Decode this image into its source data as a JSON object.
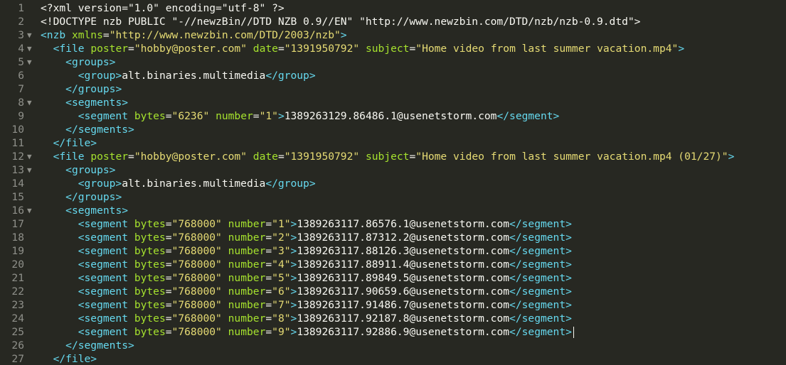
{
  "colors": {
    "background": "#272822",
    "text": "#f8f8f2",
    "tag": "#66d9ef",
    "attribute": "#a6e22e",
    "string": "#e6db74",
    "gutter": "#8f908a"
  },
  "editor": {
    "fold_icon": "▼",
    "lines": [
      {
        "n": "1",
        "fold": false,
        "indent": 0,
        "tokens": [
          {
            "t": "<?xml version=\"1.0\" encoding=\"utf-8\" ?>",
            "c": "txt"
          }
        ]
      },
      {
        "n": "2",
        "fold": false,
        "indent": 0,
        "tokens": [
          {
            "t": "<!DOCTYPE nzb PUBLIC \"-//newzBin//DTD NZB 0.9//EN\" \"http://www.newzbin.com/DTD/nzb/nzb-0.9.dtd\">",
            "c": "txt"
          }
        ]
      },
      {
        "n": "3",
        "fold": true,
        "indent": 0,
        "tokens": [
          {
            "t": "<nzb",
            "c": "tag"
          },
          {
            "t": " ",
            "c": "txt"
          },
          {
            "t": "xmlns",
            "c": "attr"
          },
          {
            "t": "=",
            "c": "txt"
          },
          {
            "t": "\"http://www.newzbin.com/DTD/2003/nzb\"",
            "c": "str"
          },
          {
            "t": ">",
            "c": "tag"
          }
        ]
      },
      {
        "n": "4",
        "fold": true,
        "indent": 1,
        "tokens": [
          {
            "t": "<file",
            "c": "tag"
          },
          {
            "t": " ",
            "c": "txt"
          },
          {
            "t": "poster",
            "c": "attr"
          },
          {
            "t": "=",
            "c": "txt"
          },
          {
            "t": "\"hobby@poster.com\"",
            "c": "str"
          },
          {
            "t": " ",
            "c": "txt"
          },
          {
            "t": "date",
            "c": "attr"
          },
          {
            "t": "=",
            "c": "txt"
          },
          {
            "t": "\"1391950792\"",
            "c": "str"
          },
          {
            "t": " ",
            "c": "txt"
          },
          {
            "t": "subject",
            "c": "attr"
          },
          {
            "t": "=",
            "c": "txt"
          },
          {
            "t": "\"Home video from last summer vacation.mp4\"",
            "c": "str"
          },
          {
            "t": ">",
            "c": "tag"
          }
        ]
      },
      {
        "n": "5",
        "fold": true,
        "indent": 2,
        "tokens": [
          {
            "t": "<groups>",
            "c": "tag"
          }
        ]
      },
      {
        "n": "6",
        "fold": false,
        "indent": 3,
        "tokens": [
          {
            "t": "<group>",
            "c": "tag"
          },
          {
            "t": "alt.binaries.multimedia",
            "c": "txt"
          },
          {
            "t": "</group>",
            "c": "tag"
          }
        ]
      },
      {
        "n": "7",
        "fold": false,
        "indent": 2,
        "tokens": [
          {
            "t": "</groups>",
            "c": "tag"
          }
        ]
      },
      {
        "n": "8",
        "fold": true,
        "indent": 2,
        "tokens": [
          {
            "t": "<segments>",
            "c": "tag"
          }
        ]
      },
      {
        "n": "9",
        "fold": false,
        "indent": 3,
        "tokens": [
          {
            "t": "<segment",
            "c": "tag"
          },
          {
            "t": " ",
            "c": "txt"
          },
          {
            "t": "bytes",
            "c": "attr"
          },
          {
            "t": "=",
            "c": "txt"
          },
          {
            "t": "\"6236\"",
            "c": "str"
          },
          {
            "t": " ",
            "c": "txt"
          },
          {
            "t": "number",
            "c": "attr"
          },
          {
            "t": "=",
            "c": "txt"
          },
          {
            "t": "\"1\"",
            "c": "str"
          },
          {
            "t": ">",
            "c": "tag"
          },
          {
            "t": "1389263129.86486.1@usenetstorm.com",
            "c": "txt"
          },
          {
            "t": "</segment>",
            "c": "tag"
          }
        ]
      },
      {
        "n": "10",
        "fold": false,
        "indent": 2,
        "tokens": [
          {
            "t": "</segments>",
            "c": "tag"
          }
        ]
      },
      {
        "n": "11",
        "fold": false,
        "indent": 1,
        "tokens": [
          {
            "t": "</file>",
            "c": "tag"
          }
        ]
      },
      {
        "n": "12",
        "fold": true,
        "indent": 1,
        "tokens": [
          {
            "t": "<file",
            "c": "tag"
          },
          {
            "t": " ",
            "c": "txt"
          },
          {
            "t": "poster",
            "c": "attr"
          },
          {
            "t": "=",
            "c": "txt"
          },
          {
            "t": "\"hobby@poster.com\"",
            "c": "str"
          },
          {
            "t": " ",
            "c": "txt"
          },
          {
            "t": "date",
            "c": "attr"
          },
          {
            "t": "=",
            "c": "txt"
          },
          {
            "t": "\"1391950792\"",
            "c": "str"
          },
          {
            "t": " ",
            "c": "txt"
          },
          {
            "t": "subject",
            "c": "attr"
          },
          {
            "t": "=",
            "c": "txt"
          },
          {
            "t": "\"Home video from last summer vacation.mp4 (01/27)\"",
            "c": "str"
          },
          {
            "t": ">",
            "c": "tag"
          }
        ]
      },
      {
        "n": "13",
        "fold": true,
        "indent": 2,
        "tokens": [
          {
            "t": "<groups>",
            "c": "tag"
          }
        ]
      },
      {
        "n": "14",
        "fold": false,
        "indent": 3,
        "tokens": [
          {
            "t": "<group>",
            "c": "tag"
          },
          {
            "t": "alt.binaries.multimedia",
            "c": "txt"
          },
          {
            "t": "</group>",
            "c": "tag"
          }
        ]
      },
      {
        "n": "15",
        "fold": false,
        "indent": 2,
        "tokens": [
          {
            "t": "</groups>",
            "c": "tag"
          }
        ]
      },
      {
        "n": "16",
        "fold": true,
        "indent": 2,
        "tokens": [
          {
            "t": "<segments>",
            "c": "tag"
          }
        ]
      },
      {
        "n": "17",
        "fold": false,
        "indent": 3,
        "tokens": [
          {
            "t": "<segment",
            "c": "tag"
          },
          {
            "t": " ",
            "c": "txt"
          },
          {
            "t": "bytes",
            "c": "attr"
          },
          {
            "t": "=",
            "c": "txt"
          },
          {
            "t": "\"768000\"",
            "c": "str"
          },
          {
            "t": " ",
            "c": "txt"
          },
          {
            "t": "number",
            "c": "attr"
          },
          {
            "t": "=",
            "c": "txt"
          },
          {
            "t": "\"1\"",
            "c": "str"
          },
          {
            "t": ">",
            "c": "tag"
          },
          {
            "t": "1389263117.86576.1@usenetstorm.com",
            "c": "txt"
          },
          {
            "t": "</segment>",
            "c": "tag"
          }
        ]
      },
      {
        "n": "18",
        "fold": false,
        "indent": 3,
        "tokens": [
          {
            "t": "<segment",
            "c": "tag"
          },
          {
            "t": " ",
            "c": "txt"
          },
          {
            "t": "bytes",
            "c": "attr"
          },
          {
            "t": "=",
            "c": "txt"
          },
          {
            "t": "\"768000\"",
            "c": "str"
          },
          {
            "t": " ",
            "c": "txt"
          },
          {
            "t": "number",
            "c": "attr"
          },
          {
            "t": "=",
            "c": "txt"
          },
          {
            "t": "\"2\"",
            "c": "str"
          },
          {
            "t": ">",
            "c": "tag"
          },
          {
            "t": "1389263117.87312.2@usenetstorm.com",
            "c": "txt"
          },
          {
            "t": "</segment>",
            "c": "tag"
          }
        ]
      },
      {
        "n": "19",
        "fold": false,
        "indent": 3,
        "tokens": [
          {
            "t": "<segment",
            "c": "tag"
          },
          {
            "t": " ",
            "c": "txt"
          },
          {
            "t": "bytes",
            "c": "attr"
          },
          {
            "t": "=",
            "c": "txt"
          },
          {
            "t": "\"768000\"",
            "c": "str"
          },
          {
            "t": " ",
            "c": "txt"
          },
          {
            "t": "number",
            "c": "attr"
          },
          {
            "t": "=",
            "c": "txt"
          },
          {
            "t": "\"3\"",
            "c": "str"
          },
          {
            "t": ">",
            "c": "tag"
          },
          {
            "t": "1389263117.88126.3@usenetstorm.com",
            "c": "txt"
          },
          {
            "t": "</segment>",
            "c": "tag"
          }
        ]
      },
      {
        "n": "20",
        "fold": false,
        "indent": 3,
        "tokens": [
          {
            "t": "<segment",
            "c": "tag"
          },
          {
            "t": " ",
            "c": "txt"
          },
          {
            "t": "bytes",
            "c": "attr"
          },
          {
            "t": "=",
            "c": "txt"
          },
          {
            "t": "\"768000\"",
            "c": "str"
          },
          {
            "t": " ",
            "c": "txt"
          },
          {
            "t": "number",
            "c": "attr"
          },
          {
            "t": "=",
            "c": "txt"
          },
          {
            "t": "\"4\"",
            "c": "str"
          },
          {
            "t": ">",
            "c": "tag"
          },
          {
            "t": "1389263117.88911.4@usenetstorm.com",
            "c": "txt"
          },
          {
            "t": "</segment>",
            "c": "tag"
          }
        ]
      },
      {
        "n": "21",
        "fold": false,
        "indent": 3,
        "tokens": [
          {
            "t": "<segment",
            "c": "tag"
          },
          {
            "t": " ",
            "c": "txt"
          },
          {
            "t": "bytes",
            "c": "attr"
          },
          {
            "t": "=",
            "c": "txt"
          },
          {
            "t": "\"768000\"",
            "c": "str"
          },
          {
            "t": " ",
            "c": "txt"
          },
          {
            "t": "number",
            "c": "attr"
          },
          {
            "t": "=",
            "c": "txt"
          },
          {
            "t": "\"5\"",
            "c": "str"
          },
          {
            "t": ">",
            "c": "tag"
          },
          {
            "t": "1389263117.89849.5@usenetstorm.com",
            "c": "txt"
          },
          {
            "t": "</segment>",
            "c": "tag"
          }
        ]
      },
      {
        "n": "22",
        "fold": false,
        "indent": 3,
        "tokens": [
          {
            "t": "<segment",
            "c": "tag"
          },
          {
            "t": " ",
            "c": "txt"
          },
          {
            "t": "bytes",
            "c": "attr"
          },
          {
            "t": "=",
            "c": "txt"
          },
          {
            "t": "\"768000\"",
            "c": "str"
          },
          {
            "t": " ",
            "c": "txt"
          },
          {
            "t": "number",
            "c": "attr"
          },
          {
            "t": "=",
            "c": "txt"
          },
          {
            "t": "\"6\"",
            "c": "str"
          },
          {
            "t": ">",
            "c": "tag"
          },
          {
            "t": "1389263117.90659.6@usenetstorm.com",
            "c": "txt"
          },
          {
            "t": "</segment>",
            "c": "tag"
          }
        ]
      },
      {
        "n": "23",
        "fold": false,
        "indent": 3,
        "tokens": [
          {
            "t": "<segment",
            "c": "tag"
          },
          {
            "t": " ",
            "c": "txt"
          },
          {
            "t": "bytes",
            "c": "attr"
          },
          {
            "t": "=",
            "c": "txt"
          },
          {
            "t": "\"768000\"",
            "c": "str"
          },
          {
            "t": " ",
            "c": "txt"
          },
          {
            "t": "number",
            "c": "attr"
          },
          {
            "t": "=",
            "c": "txt"
          },
          {
            "t": "\"7\"",
            "c": "str"
          },
          {
            "t": ">",
            "c": "tag"
          },
          {
            "t": "1389263117.91486.7@usenetstorm.com",
            "c": "txt"
          },
          {
            "t": "</segment>",
            "c": "tag"
          }
        ]
      },
      {
        "n": "24",
        "fold": false,
        "indent": 3,
        "tokens": [
          {
            "t": "<segment",
            "c": "tag"
          },
          {
            "t": " ",
            "c": "txt"
          },
          {
            "t": "bytes",
            "c": "attr"
          },
          {
            "t": "=",
            "c": "txt"
          },
          {
            "t": "\"768000\"",
            "c": "str"
          },
          {
            "t": " ",
            "c": "txt"
          },
          {
            "t": "number",
            "c": "attr"
          },
          {
            "t": "=",
            "c": "txt"
          },
          {
            "t": "\"8\"",
            "c": "str"
          },
          {
            "t": ">",
            "c": "tag"
          },
          {
            "t": "1389263117.92187.8@usenetstorm.com",
            "c": "txt"
          },
          {
            "t": "</segment>",
            "c": "tag"
          }
        ]
      },
      {
        "n": "25",
        "fold": false,
        "indent": 3,
        "cursor": true,
        "tokens": [
          {
            "t": "<segment",
            "c": "tag"
          },
          {
            "t": " ",
            "c": "txt"
          },
          {
            "t": "bytes",
            "c": "attr"
          },
          {
            "t": "=",
            "c": "txt"
          },
          {
            "t": "\"768000\"",
            "c": "str"
          },
          {
            "t": " ",
            "c": "txt"
          },
          {
            "t": "number",
            "c": "attr"
          },
          {
            "t": "=",
            "c": "txt"
          },
          {
            "t": "\"9\"",
            "c": "str"
          },
          {
            "t": ">",
            "c": "tag"
          },
          {
            "t": "1389263117.92886.9@usenetstorm.com",
            "c": "txt"
          },
          {
            "t": "</segment>",
            "c": "tag"
          }
        ]
      },
      {
        "n": "26",
        "fold": false,
        "indent": 2,
        "tokens": [
          {
            "t": "</segments>",
            "c": "tag"
          }
        ]
      },
      {
        "n": "27",
        "fold": false,
        "indent": 1,
        "tokens": [
          {
            "t": "</file>",
            "c": "tag"
          }
        ]
      }
    ]
  }
}
